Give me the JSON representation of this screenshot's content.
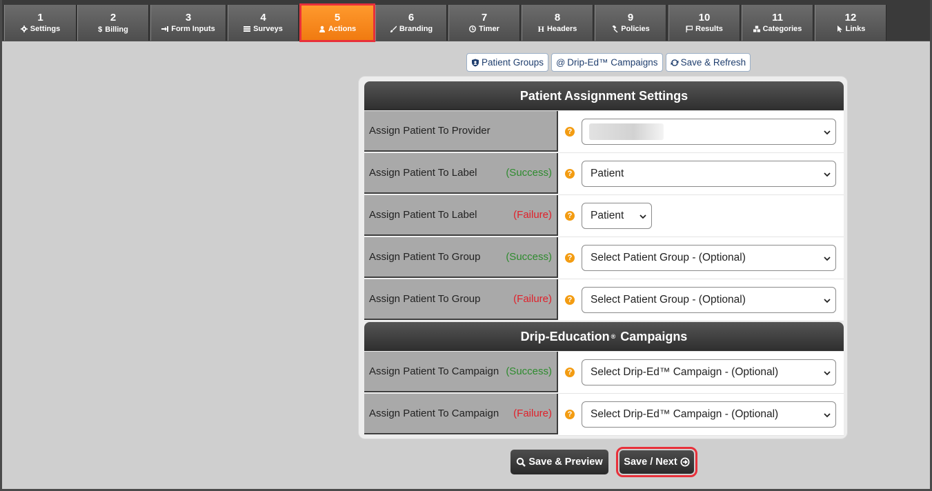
{
  "tabs": [
    {
      "num": "1",
      "label": "Settings",
      "icon": "gear-icon"
    },
    {
      "num": "2",
      "label": "Billing",
      "icon": "dollar-icon"
    },
    {
      "num": "3",
      "label": "Form Inputs",
      "icon": "sign-in-icon"
    },
    {
      "num": "4",
      "label": "Surveys",
      "icon": "list-icon"
    },
    {
      "num": "5",
      "label": "Actions",
      "icon": "user-icon"
    },
    {
      "num": "6",
      "label": "Branding",
      "icon": "brush-icon"
    },
    {
      "num": "7",
      "label": "Timer",
      "icon": "clock-icon"
    },
    {
      "num": "8",
      "label": "Headers",
      "icon": "header-icon"
    },
    {
      "num": "9",
      "label": "Policies",
      "icon": "gavel-icon"
    },
    {
      "num": "10",
      "label": "Results",
      "icon": "flag-icon"
    },
    {
      "num": "11",
      "label": "Categories",
      "icon": "cubes-icon"
    },
    {
      "num": "12",
      "label": "Links",
      "icon": "pointer-icon"
    }
  ],
  "active_tab": "5",
  "toolbar": {
    "patient_groups": "Patient Groups",
    "drip_ed_campaigns": "Drip-Ed™ Campaigns",
    "save_refresh": "Save & Refresh"
  },
  "sections": {
    "assignment_title": "Patient Assignment Settings",
    "drip_title_main": "Drip-Education",
    "drip_title_mark": "®",
    "drip_title_rest": " Campaigns"
  },
  "rows": [
    {
      "label": "Assign Patient To Provider",
      "status": "",
      "value": ""
    },
    {
      "label": "Assign Patient To Label",
      "status": "(Success)",
      "value": "Patient"
    },
    {
      "label": "Assign Patient To Label",
      "status": "(Failure)",
      "value": "Patient"
    },
    {
      "label": "Assign Patient To Group",
      "status": "(Success)",
      "value": "Select Patient Group - (Optional)"
    },
    {
      "label": "Assign Patient To Group",
      "status": "(Failure)",
      "value": "Select Patient Group - (Optional)"
    },
    {
      "label": "Assign Patient To Campaign",
      "status": "(Success)",
      "value": "Select Drip-Ed™ Campaign - (Optional)"
    },
    {
      "label": "Assign Patient To Campaign",
      "status": "(Failure)",
      "value": "Select Drip-Ed™ Campaign - (Optional)"
    }
  ],
  "help_glyph": "?",
  "buttons": {
    "save_preview": "Save & Preview",
    "save_next": "Save / Next"
  },
  "colors": {
    "active_tab": "#f58a1f",
    "highlight": "#e8303a",
    "success": "#2e8b2e",
    "failure": "#e0202a",
    "help": "#f39c12"
  }
}
